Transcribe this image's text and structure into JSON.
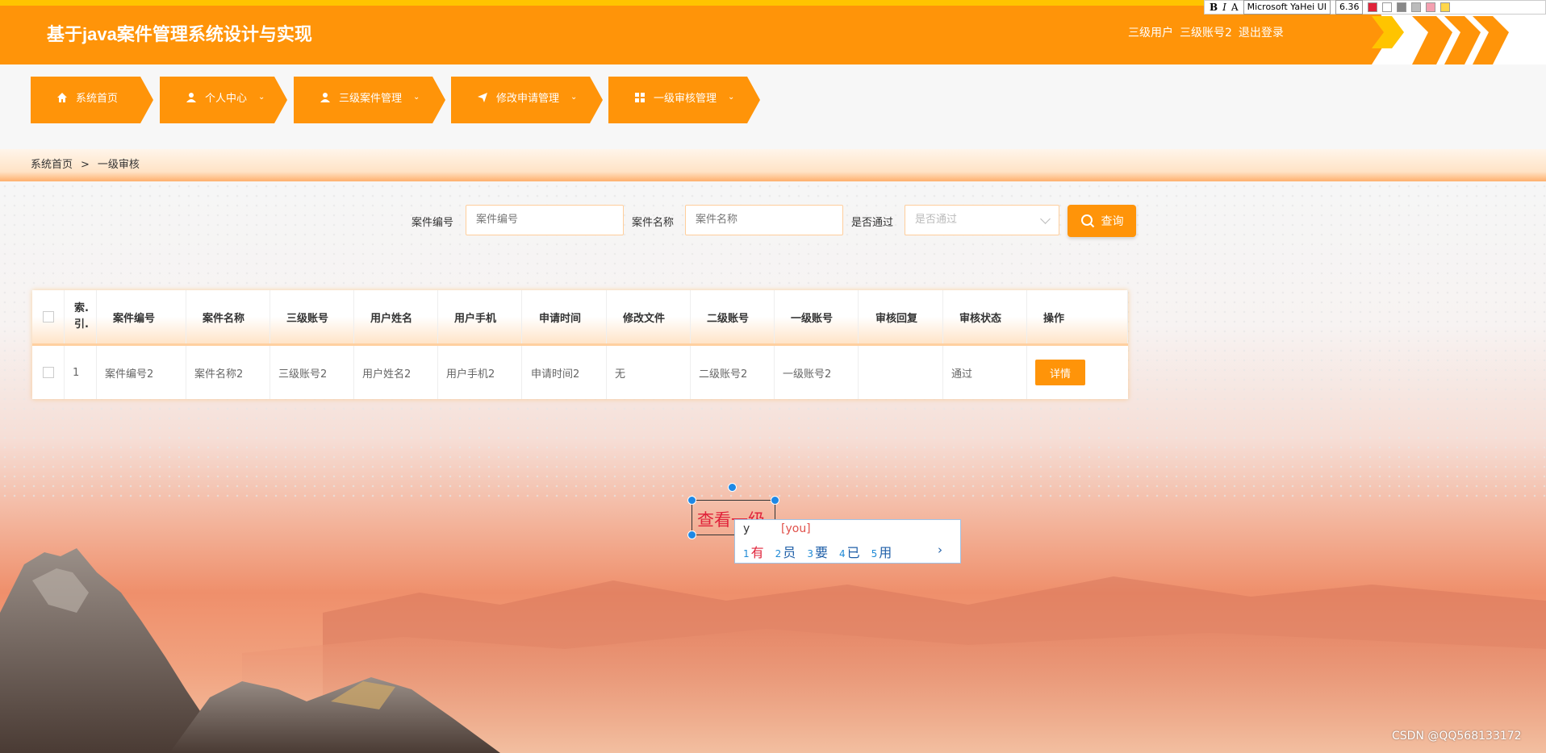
{
  "header": {
    "title": "基于java案件管理系统设计与实现",
    "role": "三级用户",
    "account": "三级账号2",
    "logout": "退出登录"
  },
  "editor_toolbar": {
    "bold": "B",
    "italic": "I",
    "text_icon": "A",
    "font": "Microsoft YaHei UI",
    "size": "6.36"
  },
  "nav": [
    {
      "label": "系统首页",
      "icon": "home-icon"
    },
    {
      "label": "个人中心",
      "icon": "user-icon"
    },
    {
      "label": "三级案件管理",
      "icon": "user-icon"
    },
    {
      "label": "修改申请管理",
      "icon": "send-icon"
    },
    {
      "label": "一级审核管理",
      "icon": "grid-icon"
    }
  ],
  "breadcrumb": {
    "home": "系统首页",
    "sep": ">",
    "current": "一级审核"
  },
  "search": {
    "case_no_label": "案件编号",
    "case_no_placeholder": "案件编号",
    "case_name_label": "案件名称",
    "case_name_placeholder": "案件名称",
    "passed_label": "是否通过",
    "passed_placeholder": "是否通过",
    "query_button": "查询"
  },
  "table": {
    "headers": [
      "索.引.",
      "案件编号",
      "案件名称",
      "三级账号",
      "用户姓名",
      "用户手机",
      "申请时间",
      "修改文件",
      "二级账号",
      "一级账号",
      "审核回复",
      "审核状态",
      "操作"
    ],
    "rows": [
      {
        "index": "1",
        "case_no": "案件编号2",
        "case_name": "案件名称2",
        "level3_account": "三级账号2",
        "user_name": "用户姓名2",
        "user_phone": "用户手机2",
        "apply_time": "申请时间2",
        "modify_file": "无",
        "level2_account": "二级账号2",
        "level1_account": "一级账号2",
        "reply": "",
        "status": "通过",
        "action": "详情"
      }
    ]
  },
  "annotation": {
    "text": "查看一级",
    "ime_input": "y",
    "ime_hint": "[you]",
    "candidates": [
      {
        "n": "1",
        "c": "有"
      },
      {
        "n": "2",
        "c": "员"
      },
      {
        "n": "3",
        "c": "要"
      },
      {
        "n": "4",
        "c": "已"
      },
      {
        "n": "5",
        "c": "用"
      }
    ],
    "next": "›"
  },
  "watermark": "CSDN @QQ568133172",
  "colors": {
    "brand": "#ff9409",
    "stripe": "#ffc400",
    "annotation_text": "#e0233a"
  }
}
